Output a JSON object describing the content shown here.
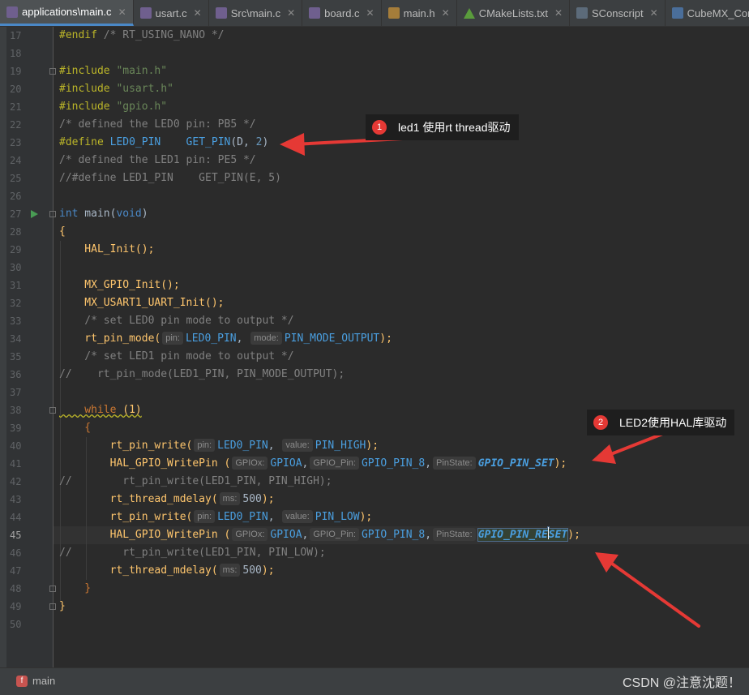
{
  "tabs": [
    {
      "label": "applications\\main.c",
      "icon": "c-file-icon",
      "active": true
    },
    {
      "label": "usart.c",
      "icon": "c-file-icon"
    },
    {
      "label": "Src\\main.c",
      "icon": "c-file-icon"
    },
    {
      "label": "board.c",
      "icon": "c-file-icon"
    },
    {
      "label": "main.h",
      "icon": "h-file-icon"
    },
    {
      "label": "CMakeLists.txt",
      "icon": "cmake-icon"
    },
    {
      "label": "SConscript",
      "icon": "text-file-icon"
    },
    {
      "label": "CubeMX_Config.i",
      "icon": "config-file-icon"
    }
  ],
  "editor": {
    "current_line": 45,
    "line_numbers": [
      "17",
      "18",
      "19",
      "20",
      "21",
      "22",
      "23",
      "24",
      "25",
      "26",
      "27",
      "28",
      "29",
      "30",
      "31",
      "32",
      "33",
      "34",
      "35",
      "36",
      "37",
      "38",
      "39",
      "40",
      "41",
      "42",
      "43",
      "44",
      "45",
      "46",
      "47",
      "48",
      "49",
      "50"
    ]
  },
  "code": {
    "l17": {
      "a": "#endif",
      "b": " /* RT_USING_NANO */"
    },
    "l19": {
      "a": "#include",
      "b": " \"main.h\""
    },
    "l20": {
      "a": "#include",
      "b": " \"usart.h\""
    },
    "l21": {
      "a": "#include",
      "b": " \"gpio.h\""
    },
    "l22": {
      "a": "/* defined the LED0 pin: PB5 */"
    },
    "l23": {
      "a": "#define",
      "b": " LED0_PIN",
      "c": "    GET_PIN",
      "d": "(D, ",
      "e": "2",
      "f": ")"
    },
    "l24": {
      "a": "/* defined the LED1 pin: PE5 */"
    },
    "l25": {
      "a": "//#define LED1_PIN    GET_PIN(E, 5)"
    },
    "l27": {
      "a": "int",
      "b": " main",
      "c": "(",
      "d": "void",
      "e": ")"
    },
    "l28": {
      "a": "{"
    },
    "l29": {
      "a": "    HAL_Init",
      "b": "();"
    },
    "l31": {
      "a": "    MX_GPIO_Init",
      "b": "();"
    },
    "l32": {
      "a": "    MX_USART1_UART_Init",
      "b": "();"
    },
    "l33": {
      "a": "    /* set LED0 pin mode to output */"
    },
    "l34": {
      "a": "    rt_pin_mode",
      "b": "(",
      "h1": "pin:",
      "c": "LED0_PIN",
      ", ": ", ",
      "h2": "mode:",
      "d": "PIN_MODE_OUTPUT",
      "e": ");"
    },
    "l35": {
      "a": "    /* set LED1 pin mode to output */"
    },
    "l36": {
      "a": "//    rt_pin_mode(LED1_PIN, PIN_MODE_OUTPUT);"
    },
    "l38": {
      "a": "    while",
      "b": " (1)"
    },
    "l39": {
      "a": "    {"
    },
    "l40": {
      "a": "        rt_pin_write",
      "b": "(",
      "h1": "pin:",
      "c": "LED0_PIN",
      "sep": ", ",
      "h2": "value:",
      "d": "PIN_HIGH",
      "e": ");"
    },
    "l41": {
      "a": "        HAL_GPIO_WritePin",
      "b": " (",
      "h1": "GPIOx:",
      "c": "GPIOA",
      "sep": ",",
      "h2": "GPIO_Pin:",
      "d": "GPIO_PIN_8",
      "sep2": ",",
      "h3": "PinState:",
      "e": "GPIO_PIN_SET",
      "f": ");"
    },
    "l42": {
      "a": "//        rt_pin_write(LED1_PIN, PIN_HIGH);"
    },
    "l43": {
      "a": "        rt_thread_mdelay",
      "b": "(",
      "h1": "ms:",
      "c": "500",
      "d": ");"
    },
    "l44": {
      "a": "        rt_pin_write",
      "b": "(",
      "h1": "pin:",
      "c": "LED0_PIN",
      "sep": ", ",
      "h2": "value:",
      "d": "PIN_LOW",
      "e": ");"
    },
    "l45": {
      "a": "        HAL_GPIO_WritePin",
      "b": " (",
      "h1": "GPIOx:",
      "c": "GPIOA",
      "sep": ",",
      "h2": "GPIO_Pin:",
      "d": "GPIO_PIN_8",
      "sep2": ",",
      "h3": "PinState:",
      "e": "GPIO_PIN_RE",
      "e2": "SET",
      "f": ");"
    },
    "l46": {
      "a": "//        rt_pin_write(LED1_PIN, PIN_LOW);"
    },
    "l47": {
      "a": "        rt_thread_mdelay",
      "b": "(",
      "h1": "ms:",
      "c": "500",
      "d": ");"
    },
    "l48": {
      "a": "    }"
    },
    "l49": {
      "a": "}"
    }
  },
  "annotations": [
    {
      "badge": "1",
      "text": "led1 使用rt thread驱动"
    },
    {
      "badge": "2",
      "text": "LED2使用HAL库驱动"
    }
  ],
  "breadcrumb": {
    "icon": "f",
    "label": "main"
  },
  "watermark": "CSDN @注意沈题！",
  "colors": {
    "background": "#2b2b2b",
    "keyword": "#cc7832",
    "string": "#6a8759",
    "comment": "#808080",
    "function": "#ffc66d",
    "constant": "#9876aa",
    "number": "#6897bb",
    "arrow": "#e53935"
  }
}
